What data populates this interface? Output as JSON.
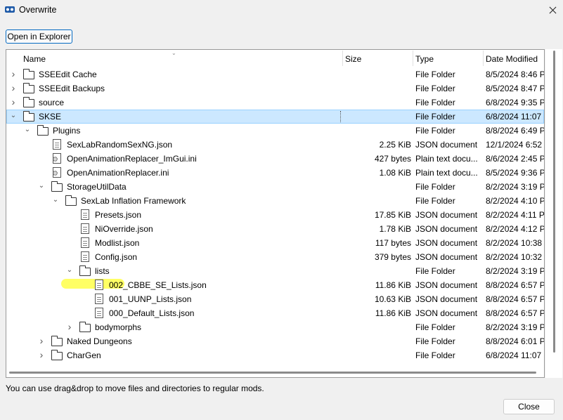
{
  "window": {
    "title": "Overwrite",
    "icon": "mo2-icon"
  },
  "toolbar": {
    "open_explorer": "Open in Explorer"
  },
  "columns": {
    "name": "Name",
    "size": "Size",
    "type": "Type",
    "date": "Date Modified"
  },
  "rows": [
    {
      "name": "SSEEdit Cache",
      "size": "",
      "type": "File Folder",
      "date": "8/5/2024 8:46 PM",
      "icon": "folder",
      "depth": 0,
      "expander": "collapsed"
    },
    {
      "name": "SSEEdit Backups",
      "size": "",
      "type": "File Folder",
      "date": "8/5/2024 8:47 PM",
      "icon": "folder",
      "depth": 0,
      "expander": "collapsed"
    },
    {
      "name": "source",
      "size": "",
      "type": "File Folder",
      "date": "6/8/2024 9:35 PM",
      "icon": "folder",
      "depth": 0,
      "expander": "collapsed"
    },
    {
      "name": "SKSE",
      "size": "",
      "type": "File Folder",
      "date": "6/8/2024 11:07 ...",
      "icon": "folder",
      "depth": 0,
      "expander": "expanded",
      "selected": true
    },
    {
      "name": "Plugins",
      "size": "",
      "type": "File Folder",
      "date": "8/8/2024 6:49 PM",
      "icon": "folder",
      "depth": 1,
      "expander": "expanded"
    },
    {
      "name": "SexLabRandomSexNG.json",
      "size": "2.25 KiB",
      "type": "JSON document",
      "date": "12/1/2024 6:52 ...",
      "icon": "file",
      "depth": 2,
      "expander": "none"
    },
    {
      "name": "OpenAnimationReplacer_ImGui.ini",
      "size": "427 bytes",
      "type": "Plain text docu...",
      "date": "8/6/2024 2:45 PM",
      "icon": "settings-file",
      "depth": 2,
      "expander": "none"
    },
    {
      "name": "OpenAnimationReplacer.ini",
      "size": "1.08 KiB",
      "type": "Plain text docu...",
      "date": "8/5/2024 9:36 PM",
      "icon": "settings-file",
      "depth": 2,
      "expander": "none"
    },
    {
      "name": "StorageUtilData",
      "size": "",
      "type": "File Folder",
      "date": "8/2/2024 3:19 PM",
      "icon": "folder",
      "depth": 2,
      "expander": "expanded"
    },
    {
      "name": "SexLab Inflation Framework",
      "size": "",
      "type": "File Folder",
      "date": "8/2/2024 4:10 PM",
      "icon": "folder",
      "depth": 3,
      "expander": "expanded"
    },
    {
      "name": "Presets.json",
      "size": "17.85 KiB",
      "type": "JSON document",
      "date": "8/2/2024 4:11 PM",
      "icon": "file",
      "depth": 4,
      "expander": "none"
    },
    {
      "name": "NiOverride.json",
      "size": "1.78 KiB",
      "type": "JSON document",
      "date": "8/2/2024 4:12 PM",
      "icon": "file",
      "depth": 4,
      "expander": "none"
    },
    {
      "name": "Modlist.json",
      "size": "117 bytes",
      "type": "JSON document",
      "date": "8/2/2024 10:38 ...",
      "icon": "file",
      "depth": 4,
      "expander": "none"
    },
    {
      "name": "Config.json",
      "size": "379 bytes",
      "type": "JSON document",
      "date": "8/2/2024 10:32 ...",
      "icon": "file",
      "depth": 4,
      "expander": "none"
    },
    {
      "name": "lists",
      "size": "",
      "type": "File Folder",
      "date": "8/2/2024 3:19 PM",
      "icon": "folder",
      "depth": 4,
      "expander": "expanded"
    },
    {
      "name": "002_CBBE_SE_Lists.json",
      "size": "11.86 KiB",
      "type": "JSON document",
      "date": "8/8/2024 6:57 PM",
      "icon": "file",
      "depth": 5,
      "expander": "none"
    },
    {
      "name": "001_UUNP_Lists.json",
      "size": "10.63 KiB",
      "type": "JSON document",
      "date": "8/8/2024 6:57 PM",
      "icon": "file",
      "depth": 5,
      "expander": "none"
    },
    {
      "name": "000_Default_Lists.json",
      "size": "11.86 KiB",
      "type": "JSON document",
      "date": "8/8/2024 6:57 PM",
      "icon": "file",
      "depth": 5,
      "expander": "none"
    },
    {
      "name": "bodymorphs",
      "size": "",
      "type": "File Folder",
      "date": "8/2/2024 3:19 PM",
      "icon": "folder",
      "depth": 4,
      "expander": "collapsed"
    },
    {
      "name": "Naked Dungeons",
      "size": "",
      "type": "File Folder",
      "date": "8/8/2024 6:01 PM",
      "icon": "folder",
      "depth": 2,
      "expander": "collapsed"
    },
    {
      "name": "CharGen",
      "size": "",
      "type": "File Folder",
      "date": "6/8/2024 11:07 ...",
      "icon": "folder",
      "depth": 2,
      "expander": "collapsed"
    }
  ],
  "status": "You can use drag&drop to move files and directories to regular mods.",
  "footer": {
    "close": "Close"
  },
  "colors": {
    "selection": "#cce8ff",
    "highlight": "#ffff4a",
    "accent": "#0067c0"
  }
}
